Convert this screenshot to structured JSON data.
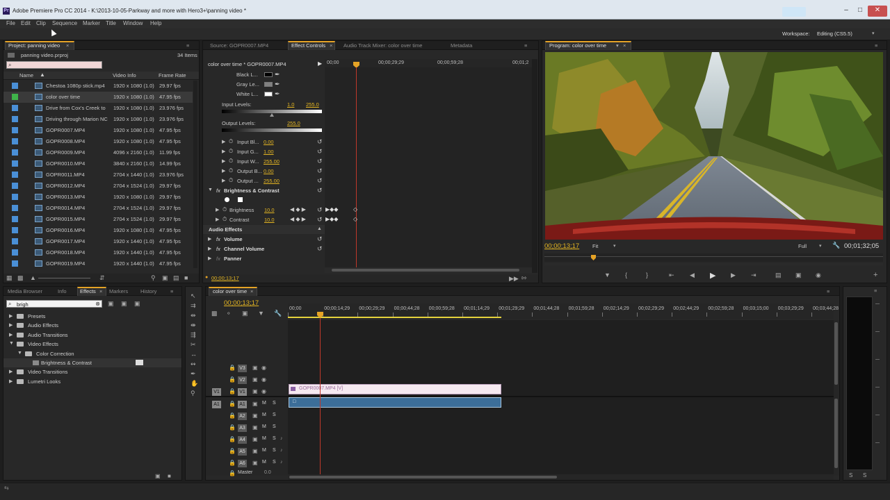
{
  "window": {
    "title": "Adobe Premiere Pro CC 2014 - K:\\2013-10-05-Parkway and more with Hero3+\\panning video *",
    "app_icon": "Pr"
  },
  "menu": [
    "File",
    "Edit",
    "Clip",
    "Sequence",
    "Marker",
    "Title",
    "Window",
    "Help"
  ],
  "workspace": {
    "label": "Workspace:",
    "value": "Editing (CS5.5)"
  },
  "project": {
    "tab": "Project: panning video",
    "file": "panning video.prproj",
    "item_count": "34 Items",
    "columns": [
      "Name",
      "Video Info",
      "Frame Rate"
    ],
    "items": [
      {
        "name": "Chestoa 1080p stick.mp4",
        "info": "1920 x 1080 (1.0)",
        "rate": "29.97 fps",
        "color": "#4a8fd6"
      },
      {
        "name": "color over time",
        "info": "1920 x 1080 (1.0)",
        "rate": "47.95 fps",
        "color": "#3fb24a"
      },
      {
        "name": "Drive from Cox's Creek to",
        "info": "1920 x 1080 (1.0)",
        "rate": "23.976 fps",
        "color": "#4a8fd6"
      },
      {
        "name": "Driving through Marion NC",
        "info": "1920 x 1080 (1.0)",
        "rate": "23.976 fps",
        "color": "#4a8fd6"
      },
      {
        "name": "GOPR0007.MP4",
        "info": "1920 x 1080 (1.0)",
        "rate": "47.95 fps",
        "color": "#4a8fd6"
      },
      {
        "name": "GOPR0008.MP4",
        "info": "1920 x 1080 (1.0)",
        "rate": "47.95 fps",
        "color": "#4a8fd6"
      },
      {
        "name": "GOPR0009.MP4",
        "info": "4096 x 2160 (1.0)",
        "rate": "11.99 fps",
        "color": "#4a8fd6"
      },
      {
        "name": "GOPR0010.MP4",
        "info": "3840 x 2160 (1.0)",
        "rate": "14.99 fps",
        "color": "#4a8fd6"
      },
      {
        "name": "GOPR0011.MP4",
        "info": "2704 x 1440 (1.0)",
        "rate": "23.976 fps",
        "color": "#4a8fd6"
      },
      {
        "name": "GOPR0012.MP4",
        "info": "2704 x 1524 (1.0)",
        "rate": "29.97 fps",
        "color": "#4a8fd6"
      },
      {
        "name": "GOPR0013.MP4",
        "info": "1920 x 1080 (1.0)",
        "rate": "29.97 fps",
        "color": "#4a8fd6"
      },
      {
        "name": "GOPR0014.MP4",
        "info": "2704 x 1524 (1.0)",
        "rate": "29.97 fps",
        "color": "#4a8fd6"
      },
      {
        "name": "GOPR0015.MP4",
        "info": "2704 x 1524 (1.0)",
        "rate": "29.97 fps",
        "color": "#4a8fd6"
      },
      {
        "name": "GOPR0016.MP4",
        "info": "1920 x 1080 (1.0)",
        "rate": "47.95 fps",
        "color": "#4a8fd6"
      },
      {
        "name": "GOPR0017.MP4",
        "info": "1920 x 1440 (1.0)",
        "rate": "47.95 fps",
        "color": "#4a8fd6"
      },
      {
        "name": "GOPR0018.MP4",
        "info": "1920 x 1440 (1.0)",
        "rate": "47.95 fps",
        "color": "#4a8fd6"
      },
      {
        "name": "GOPR0019.MP4",
        "info": "1920 x 1440 (1.0)",
        "rate": "47.95 fps",
        "color": "#4a8fd6"
      }
    ]
  },
  "source_tabs": [
    "Source: GOPR0007.MP4",
    "Effect Controls",
    "Audio Track Mixer: color over time",
    "Metadata"
  ],
  "effect_controls": {
    "clip": "color over time * GOPR0007.MP4",
    "ruler": [
      "00;00",
      "00;00;29;29",
      "00;00;59;28",
      "00;01;2"
    ],
    "black": "Black L...",
    "gray": "Gray Le...",
    "white": "White L...",
    "input_levels_label": "Input Levels:",
    "input_low": "1.0",
    "input_high": "255.0",
    "output_levels_label": "Output Levels:",
    "output_high": "255.0",
    "params": [
      {
        "label": "Input Bl...",
        "value": "0.00"
      },
      {
        "label": "Input G...",
        "value": "1.00"
      },
      {
        "label": "Input W...",
        "value": "255.00"
      },
      {
        "label": "Output B...",
        "value": "0.00"
      },
      {
        "label": "Output ...",
        "value": "255.00"
      }
    ],
    "bc_title": "Brightness & Contrast",
    "brightness_label": "Brightness",
    "brightness_value": "10.0",
    "contrast_label": "Contrast",
    "contrast_value": "10.0",
    "audio_effects": "Audio Effects",
    "volume": "Volume",
    "channel_volume": "Channel Volume",
    "panner": "Panner",
    "timecode": "00;00;13;17"
  },
  "program": {
    "tab": "Program: color over time",
    "timecode": "00;00;13;17",
    "fit": "Fit",
    "quality": "Full",
    "duration": "00;01;32;05"
  },
  "effects_panel": {
    "tabs": [
      "Media Browser",
      "Info",
      "Effects",
      "Markers",
      "History"
    ],
    "search": "brigh",
    "tree": [
      {
        "label": "Presets",
        "level": 0,
        "open": false
      },
      {
        "label": "Audio Effects",
        "level": 0,
        "open": false
      },
      {
        "label": "Audio Transitions",
        "level": 0,
        "open": false
      },
      {
        "label": "Video Effects",
        "level": 0,
        "open": true
      },
      {
        "label": "Color Correction",
        "level": 1,
        "open": true
      },
      {
        "label": "Brightness & Contrast",
        "level": 2,
        "open": false
      },
      {
        "label": "Video Transitions",
        "level": 0,
        "open": false
      },
      {
        "label": "Lumetri Looks",
        "level": 0,
        "open": false
      }
    ]
  },
  "timeline": {
    "tab": "color over time",
    "timecode": "00;00;13;17",
    "ruler": [
      "00;00",
      "00;00;14;29",
      "00;00;29;29",
      "00;00;44;28",
      "00;00;59;28",
      "00;01;14;29",
      "00;01;29;29",
      "00;01;44;28",
      "00;01;59;28",
      "00;02;14;29",
      "00;02;29;29",
      "00;02;44;29",
      "00;02;59;28",
      "00;03;15;00",
      "00;03;29;29",
      "00;03;44;28"
    ],
    "video_tracks": [
      "V3",
      "V2",
      "V1"
    ],
    "audio_tracks": [
      "A1",
      "A2",
      "A3",
      "A4",
      "A5",
      "A6"
    ],
    "master": "Master",
    "master_value": "0.0",
    "source_v": "V1",
    "source_a": "A1",
    "clip_video": "GOPR0007.MP4 [V]",
    "mute": "M",
    "solo": "S"
  }
}
